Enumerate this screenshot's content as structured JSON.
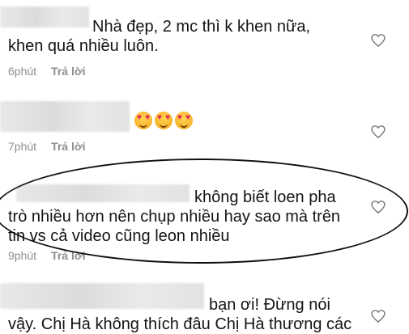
{
  "comments": [
    {
      "text_lines": [
        "Nhà đẹp, 2 mc thì k khen nữa,",
        "khen quá nhiều luôn."
      ],
      "time": "6phút",
      "reply": "Trả lời"
    },
    {
      "emojis": [
        "heart-eyes-emoji",
        "heart-eyes-emoji",
        "heart-eyes-emoji"
      ],
      "time": "7phút",
      "reply": "Trả lời"
    },
    {
      "text_lines": [
        "không biết loen pha",
        "trò nhiều hơn nên chụp nhiều hay sao mà trên",
        "tin vs cả video cũng leon nhiều"
      ],
      "time": "9phút",
      "reply": "Trả lời"
    },
    {
      "text_lines": [
        "bạn ơi! Đừng nói",
        "vậy. Chị Hà không thích đâu Chị Hà thương các"
      ]
    }
  ],
  "icons": {
    "like": "heart-outline-icon"
  },
  "colors": {
    "text": "#141414",
    "meta": "#8e8e8e",
    "annotation": "#111111"
  }
}
